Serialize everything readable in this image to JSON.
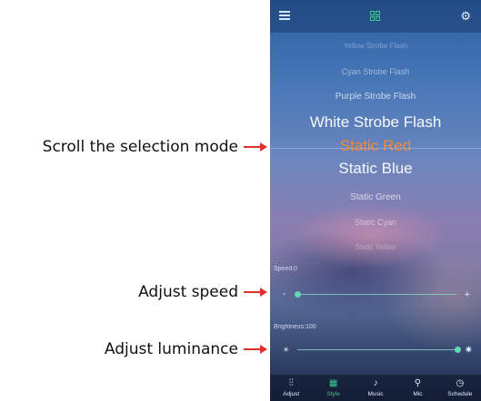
{
  "callouts": {
    "scroll": "Scroll the selection mode",
    "speed": "Adjust speed",
    "luminance": "Adjust luminance"
  },
  "topbar": {
    "menu_icon": "menu-icon",
    "center_icon": "grid-icon",
    "settings_icon": "gear-icon"
  },
  "modes": {
    "items": [
      "Yellow Strobe Flash",
      "Cyan Strobe Flash",
      "Purple Strobe Flash",
      "White Strobe Flash",
      "Static Red",
      "Static Blue",
      "Static Green",
      "Static Cyan",
      "Static Yellow"
    ],
    "selected_index": 4,
    "selected_color": "#f28a3a"
  },
  "speed": {
    "label": "Speed:0",
    "value": 0,
    "min_symbol": "-",
    "max_symbol": "+"
  },
  "brightness": {
    "label": "Brightness:100",
    "value": 100
  },
  "tabs": [
    {
      "label": "Adjust",
      "icon": "sliders-icon",
      "glyph": "⫶⫶"
    },
    {
      "label": "Style",
      "icon": "grid-icon",
      "glyph": "▦"
    },
    {
      "label": "Music",
      "icon": "music-icon",
      "glyph": "♪"
    },
    {
      "label": "Mic",
      "icon": "microphone-icon",
      "glyph": "⚲"
    },
    {
      "label": "Schedule",
      "icon": "clock-icon",
      "glyph": "◷"
    }
  ],
  "active_tab": 1,
  "colors": {
    "accent": "#3ec88e",
    "selected_mode": "#f28a3a",
    "callout_arrow": "#e0302a"
  }
}
